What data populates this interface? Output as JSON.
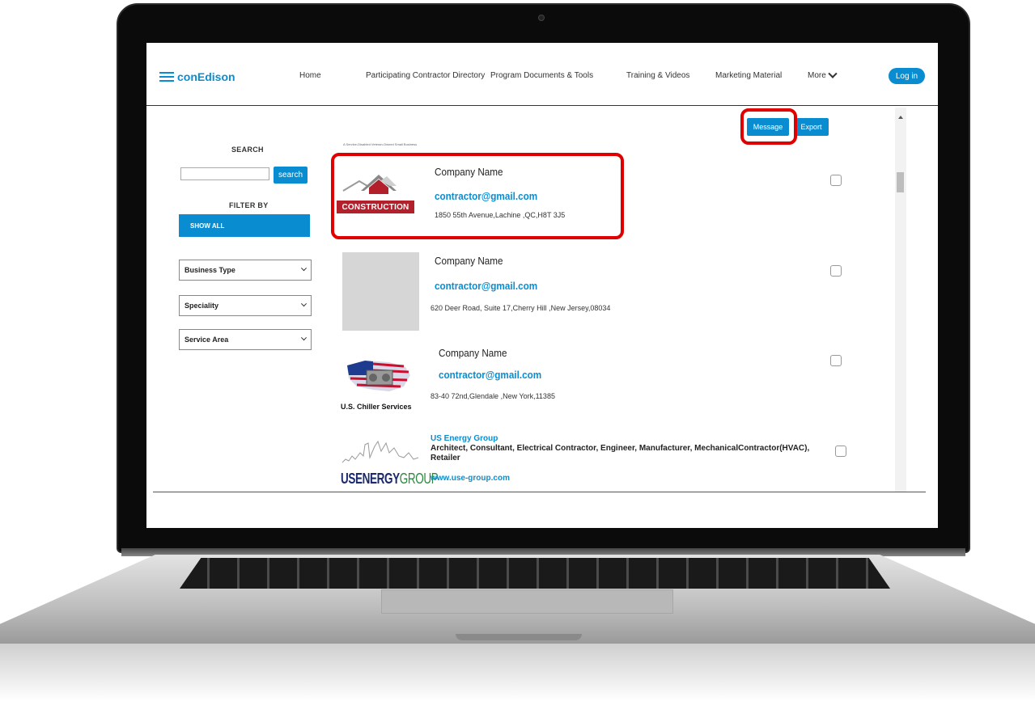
{
  "brand": {
    "name": "conEdison",
    "color": "#0a8dd0"
  },
  "nav": {
    "items": [
      "Home",
      "Participating Contractor Directory",
      "Program Documents & Tools",
      "Training & Videos",
      "Marketing Material"
    ],
    "more_label": "More",
    "login_label": "Log in"
  },
  "sidebar": {
    "search_title": "SEARCH",
    "search_value": "",
    "search_button": "search",
    "filter_title": "FILTER BY",
    "show_all": "SHOW ALL",
    "filters": [
      "Business Type",
      "Speciality",
      "Service Area"
    ]
  },
  "actions": {
    "message": "Message",
    "export": "Export"
  },
  "tiny_caption": "A Service-Disabled Veteran-Owned Small Business",
  "listings": [
    {
      "company": "Company Name",
      "email": "contractor@gmail.com",
      "address": "1850 55th Avenue,Lachine ,QC,H8T 3J5",
      "logo_text": "CONSTRUCTION"
    },
    {
      "company": "Company Name",
      "email": "contractor@gmail.com",
      "address": "620 Deer Road, Suite 17,Cherry Hill ,New Jersey,08034"
    },
    {
      "company": "Company Name",
      "email": "contractor@gmail.com",
      "address": "83-40 72nd,Glendale ,New York,11385",
      "logo_text": "U.S. Chiller Services"
    }
  ],
  "us_energy": {
    "name": "US Energy Group",
    "description": "Architect, Consultant, Electrical Contractor, Engineer, Manufacturer, MechanicalContractor(HVAC), Retailer",
    "website": "www.use-group.com",
    "logo_text_a": "USENERGY",
    "logo_text_b": "GROUP"
  },
  "colors": {
    "accent": "#0a8dd0",
    "highlight": "#e00000",
    "construction_red": "#b3202b"
  },
  "icons": [
    "chevron-down-icon",
    "checkbox-icon",
    "scroll-up-arrow-icon"
  ]
}
